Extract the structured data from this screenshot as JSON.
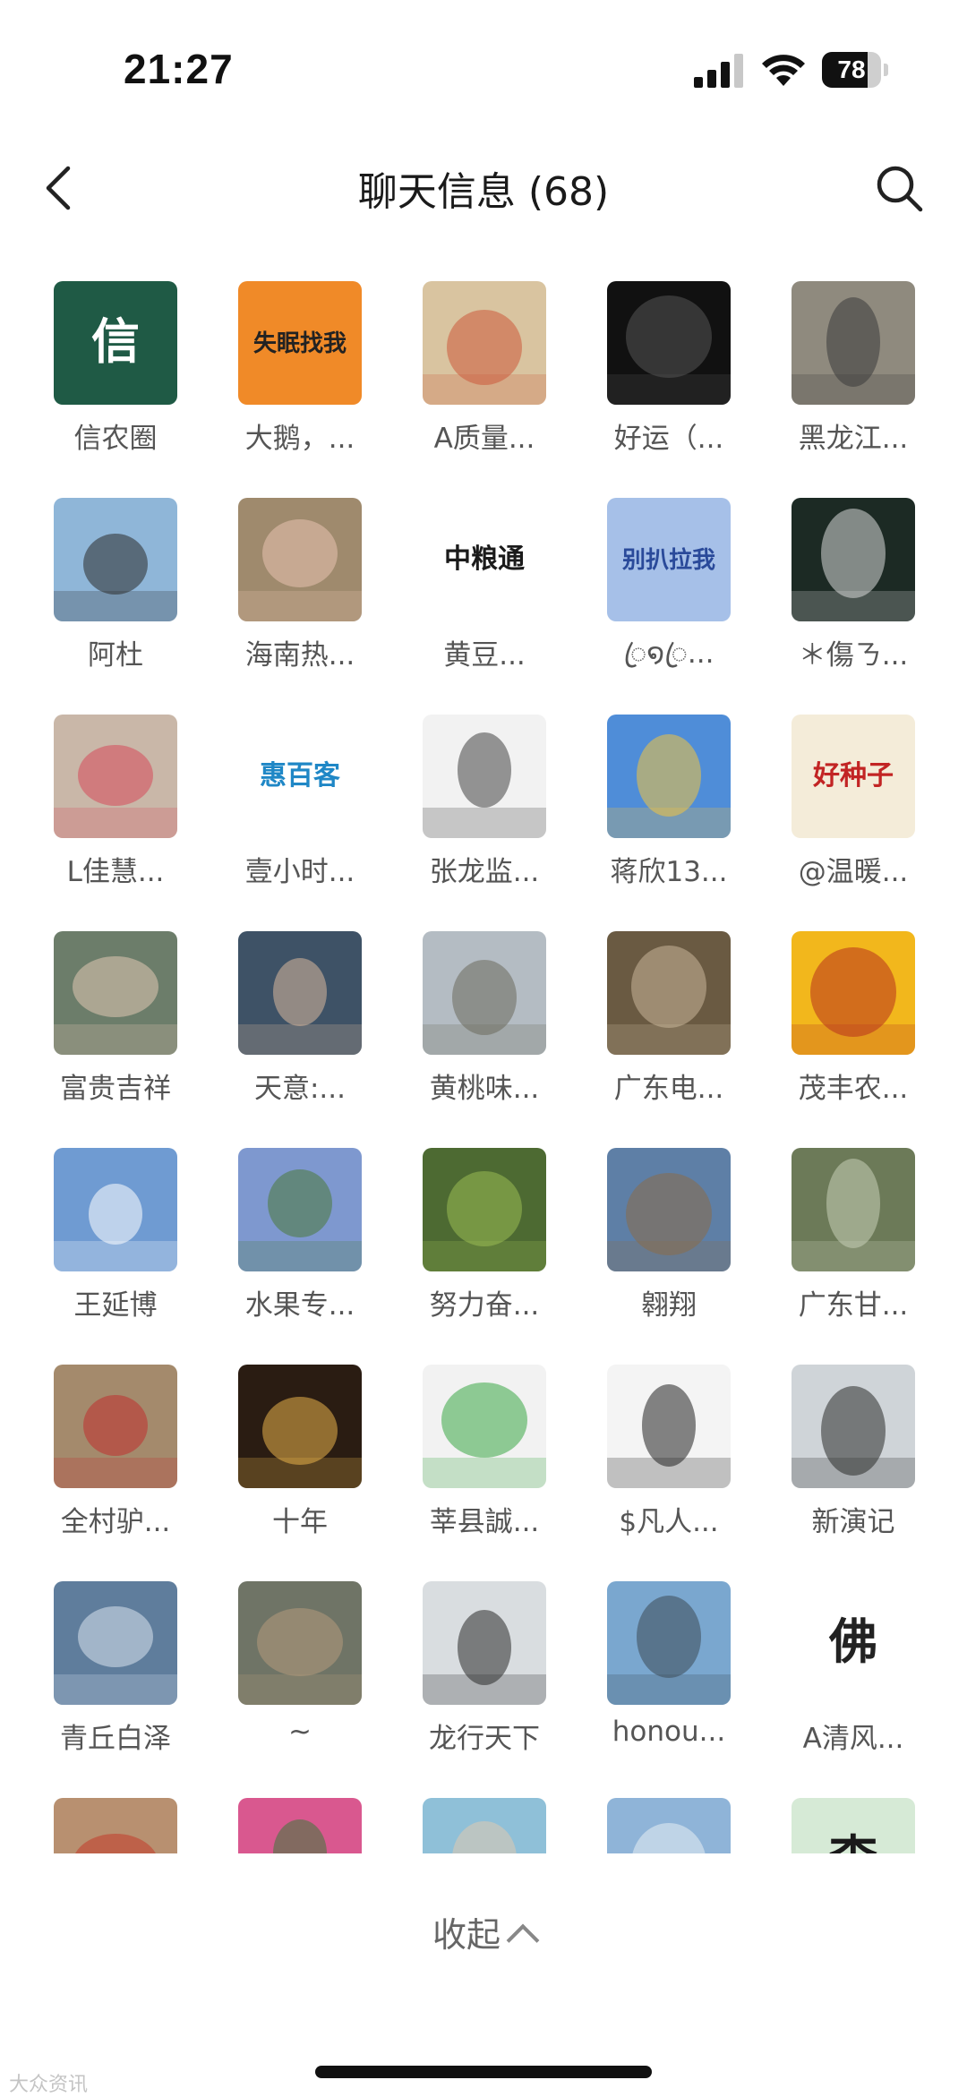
{
  "status_bar": {
    "time": "21:27",
    "battery_level": "78",
    "battery_fraction": 0.78
  },
  "header": {
    "title": "聊天信息 (68)",
    "back_icon": "chevron-left-icon",
    "search_icon": "search-icon"
  },
  "members": [
    {
      "name": "信农圈",
      "avatar_text": "信",
      "bg": "#1f5a45",
      "fg": "#ffffff"
    },
    {
      "name": "大鹅，...",
      "avatar_text": "失眠找我",
      "bg": "#f08a28",
      "fg": "#222222"
    },
    {
      "name": "A质量...",
      "avatar_text": "",
      "bg": "#d9c4a0",
      "fg": "#cc5a3a"
    },
    {
      "name": "好运（...",
      "avatar_text": "",
      "bg": "#111111",
      "fg": "#555555"
    },
    {
      "name": "黑龙江...",
      "avatar_text": "",
      "bg": "#8f8a7e",
      "fg": "#3a3a3a"
    },
    {
      "name": "阿杜",
      "avatar_text": "",
      "bg": "#8fb6d8",
      "fg": "#2b2b2b"
    },
    {
      "name": "海南热...",
      "avatar_text": "",
      "bg": "#9f8a6d",
      "fg": "#e8c2b0"
    },
    {
      "name": "黄豆...",
      "avatar_text": "中粮通",
      "bg": "#ffffff",
      "fg": "#1b1b1b"
    },
    {
      "name": "ꦿ໑ꦿ...",
      "avatar_text": "别扒拉我",
      "bg": "#a6c0e8",
      "fg": "#2a4a9a"
    },
    {
      "name": "＊傷ㄋ...",
      "avatar_text": "",
      "bg": "#1c2a24",
      "fg": "#d9d9d9"
    },
    {
      "name": "L佳慧...",
      "avatar_text": "",
      "bg": "#c9b7a8",
      "fg": "#d64a5a"
    },
    {
      "name": "壹小时...",
      "avatar_text": "惠百客",
      "bg": "#ffffff",
      "fg": "#1f87c6"
    },
    {
      "name": "张龙监...",
      "avatar_text": "",
      "bg": "#f2f2f2",
      "fg": "#444444"
    },
    {
      "name": "蒋欣13...",
      "avatar_text": "",
      "bg": "#4f8dd8",
      "fg": "#f2c440"
    },
    {
      "name": "@温暖...",
      "avatar_text": "好种子",
      "bg": "#f4ecd9",
      "fg": "#c22424"
    },
    {
      "name": "富贵吉祥",
      "avatar_text": "",
      "bg": "#6c7d6a",
      "fg": "#e2c8b2"
    },
    {
      "name": "天意:...",
      "avatar_text": "",
      "bg": "#3e5266",
      "fg": "#d8b89c"
    },
    {
      "name": "黄桃味...",
      "avatar_text": "",
      "bg": "#b4bcc3",
      "fg": "#6b6a5c"
    },
    {
      "name": "广东电...",
      "avatar_text": "",
      "bg": "#6a5a42",
      "fg": "#c9b79a"
    },
    {
      "name": "茂丰农...",
      "avatar_text": "",
      "bg": "#f2b71c",
      "fg": "#b8321e"
    },
    {
      "name": "王延博",
      "avatar_text": "",
      "bg": "#6f9bd2",
      "fg": "#ffffff"
    },
    {
      "name": "水果专...",
      "avatar_text": "",
      "bg": "#7e98cf",
      "fg": "#4a7a3a"
    },
    {
      "name": "努力奋...",
      "avatar_text": "",
      "bg": "#4d6a32",
      "fg": "#9bbb54"
    },
    {
      "name": "翱翔",
      "avatar_text": "",
      "bg": "#5e7fa6",
      "fg": "#8a6b48"
    },
    {
      "name": "广东甘...",
      "avatar_text": "",
      "bg": "#6c7a58",
      "fg": "#c9d0b8"
    },
    {
      "name": "全村驴...",
      "avatar_text": "",
      "bg": "#a48a6c",
      "fg": "#c03030"
    },
    {
      "name": "十年",
      "avatar_text": "",
      "bg": "#2a1c12",
      "fg": "#e8b24a"
    },
    {
      "name": "莘县誠...",
      "avatar_text": "",
      "bg": "#f2f2f2",
      "fg": "#3aa845"
    },
    {
      "name": "$凡人...",
      "avatar_text": "",
      "bg": "#f4f4f4",
      "fg": "#222222"
    },
    {
      "name": "新演记",
      "avatar_text": "",
      "bg": "#cfd4d8",
      "fg": "#2b2b2b"
    },
    {
      "name": "青丘白泽",
      "avatar_text": "",
      "bg": "#5f7d9c",
      "fg": "#d9e4ef"
    },
    {
      "name": "~",
      "avatar_text": "",
      "bg": "#6f7466",
      "fg": "#b59a7c"
    },
    {
      "name": "龙行天下",
      "avatar_text": "",
      "bg": "#d9dde0",
      "fg": "#2a2a2a"
    },
    {
      "name": "honou...",
      "avatar_text": "",
      "bg": "#7aa7cf",
      "fg": "#3c4a56"
    },
    {
      "name": "A清风...",
      "avatar_text": "佛",
      "bg": "#ffffff",
      "fg": "#222222"
    },
    {
      "name": "",
      "avatar_text": "",
      "bg": "#b89070",
      "fg": "#c23a2a"
    },
    {
      "name": "",
      "avatar_text": "",
      "bg": "#d9588f",
      "fg": "#3a7a3a"
    },
    {
      "name": "",
      "avatar_text": "",
      "bg": "#8fc0d8",
      "fg": "#e0c8b0"
    },
    {
      "name": "",
      "avatar_text": "",
      "bg": "#8fb4d8",
      "fg": "#e8eef4"
    },
    {
      "name": "",
      "avatar_text": "李",
      "bg": "#d6ead6",
      "fg": "#1a1a1a"
    }
  ],
  "collapse_label": "收起",
  "collapse_icon": "chevron-up-icon",
  "watermark": "大众资讯"
}
